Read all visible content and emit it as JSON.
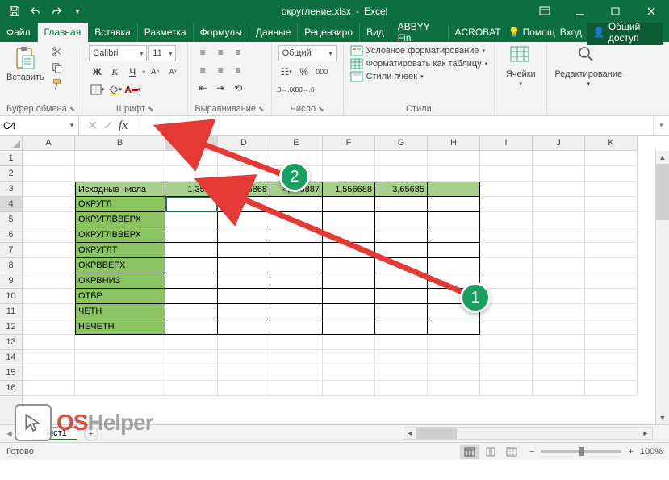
{
  "title": {
    "filename": "округление.xlsx",
    "app": "Excel"
  },
  "tabs": {
    "file": "Файл",
    "home": "Главная",
    "insert": "Вставка",
    "layout": "Разметка",
    "formulas": "Формулы",
    "data": "Данные",
    "review": "Рецензиро",
    "view": "Вид",
    "abbyy": "ABBYY Fin",
    "acrobat": "ACROBAT",
    "tell_me": "Помощ",
    "sign_in": "Вход",
    "share": "Общий доступ"
  },
  "ribbon": {
    "paste_label": "Вставить",
    "clipboard_group": "Буфер обмена",
    "font_name": "Calibri",
    "font_size": "11",
    "bold": "Ж",
    "italic": "К",
    "underline": "Ч",
    "font_group": "Шрифт",
    "alignment_group": "Выравнивание",
    "number_format": "Общий",
    "number_group": "Число",
    "cond_format": "Условное форматирование",
    "format_table": "Форматировать как таблицу",
    "cell_styles": "Стили ячеек",
    "styles_group": "Стили",
    "cells_label": "Ячейки",
    "editing_label": "Редактирование"
  },
  "namebox": "C4",
  "columns": [
    "A",
    "B",
    "C",
    "D",
    "E",
    "F",
    "G",
    "H",
    "I",
    "J",
    "K"
  ],
  "rows": [
    "1",
    "2",
    "3",
    "4",
    "5",
    "6",
    "7",
    "8",
    "9",
    "10",
    "11",
    "12",
    "13",
    "14",
    "15",
    "16"
  ],
  "data_header_label": "Исходные числа",
  "data_values": [
    "1,3548",
    "2,156868",
    "4,546887",
    "1,556688",
    "3,65685"
  ],
  "row_labels": [
    "ОКРУГЛ",
    "ОКРУГЛВВЕРХ",
    "ОКРУГЛВВЕРХ",
    "ОКРУГЛТ",
    "ОКРВВЕРХ",
    "ОКРВНИЗ",
    "ОТБР",
    "ЧЕТН",
    "НЕЧЕТН"
  ],
  "sheet_tab": "Лист1",
  "status_ready": "Готово",
  "zoom": "100%",
  "annotations": {
    "one": "1",
    "two": "2"
  },
  "watermark": {
    "os": "OS",
    "helper": "Helper"
  }
}
